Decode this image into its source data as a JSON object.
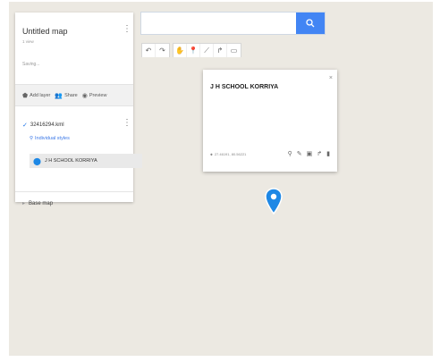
{
  "panel": {
    "title": "Untitled map",
    "views": "1 view",
    "status": "Saving...",
    "actions": [
      {
        "icon": "add-layer-icon",
        "label": "Add layer"
      },
      {
        "icon": "share-icon",
        "label": "Share"
      },
      {
        "icon": "preview-icon",
        "label": "Preview"
      }
    ],
    "layer_name": "32416294.kml",
    "styles_link": "Individual styles",
    "feature_name": "J H SCHOOL KORRIYA",
    "base_map": "Base map"
  },
  "search": {
    "value": "",
    "placeholder": ""
  },
  "toolbar": [
    "undo-icon",
    "redo-icon",
    "select-icon",
    "marker-icon",
    "line-icon",
    "route-icon",
    "ruler-icon"
  ],
  "popup": {
    "title": "J H SCHOOL KORRIYA",
    "coords": "27.46191, 80.56221"
  },
  "colors": {
    "accent": "#4285f4",
    "marker": "#1e88e5",
    "map_bg": "#ece9e2"
  }
}
